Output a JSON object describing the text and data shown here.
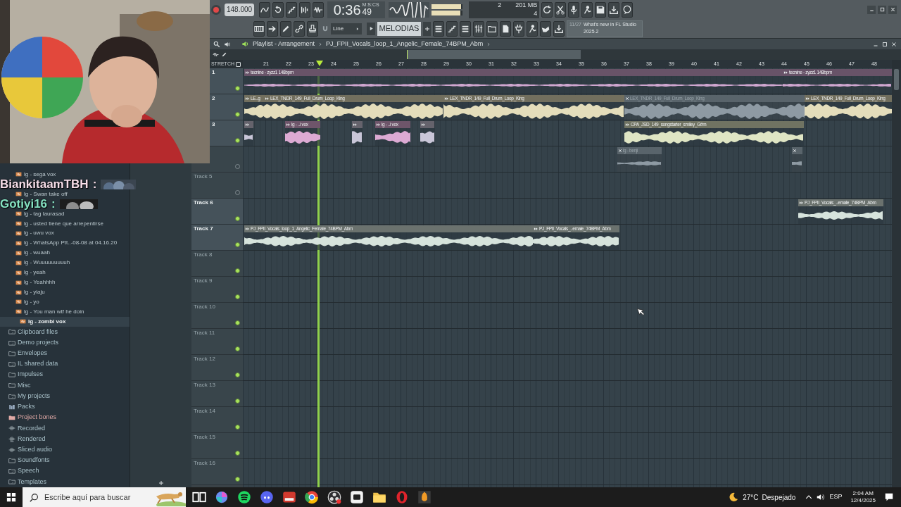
{
  "chat": [
    {
      "user": "BiankitaamTBH",
      "separator": ":",
      "color": "#f6dde8"
    },
    {
      "user": "Gotiyi16",
      "separator": ":",
      "color": "#86e3c3"
    }
  ],
  "toolbar": {
    "tempo": "148.000",
    "time": "0:36",
    "time_format": "M:S:CS",
    "time_cs": "49",
    "meters": [
      {
        "level": 0.95
      },
      {
        "level": 0.92
      }
    ],
    "cpu": "2",
    "memory": "201 MB",
    "polyphony": "4",
    "snap": "Line",
    "pattern": "MELODIAS",
    "news_count": "11/27",
    "news": "What's new in FL Studio 2025.2"
  },
  "playlist": {
    "title": "Playlist - Arrangement",
    "breadcrumb": "PJ_FPII_Vocals_loop_1_Angelic_Female_74BPM_Abm",
    "stretch": "STRETCH",
    "stretch_checked": false,
    "ruler": [
      "21",
      "22",
      "23",
      "24",
      "25",
      "26",
      "27",
      "28",
      "29",
      "30",
      "31",
      "32",
      "33",
      "34",
      "35",
      "36",
      "37",
      "38",
      "39",
      "40",
      "41",
      "42",
      "43",
      "44",
      "45",
      "46",
      "47",
      "48"
    ],
    "tracks": [
      {
        "label": "1",
        "on": true,
        "bright": true,
        "clips": [
          {
            "label": "tecnine - zyzz1 148bpm",
            "color": "#cfa6cf",
            "muted": false
          },
          {
            "label": "tecnine - zyzz1 148bpm",
            "color": "#cfa6cf",
            "muted": false
          }
        ]
      },
      {
        "label": "2",
        "on": true,
        "bright": true,
        "clips": [
          {
            "label": "LE..g",
            "color": "#e4ddbb",
            "muted": false
          },
          {
            "label": "LEX_TNDR_149_Full_Drum_Loop_King",
            "color": "#e4ddbb",
            "muted": false
          },
          {
            "label": "LEX_TNDR_149_Full_Drum_Loop_King",
            "color": "#e4ddbb",
            "muted": false
          },
          {
            "label": "LEX_TNDR_149_Full_Drum_Loop_King",
            "color": "#8e9aa3",
            "muted": true
          },
          {
            "label": "LEX_TNDR_149_Full_Drum_Loop_King",
            "color": "#e4ddbb",
            "muted": false
          }
        ]
      },
      {
        "label": "3",
        "on": true,
        "bright": true,
        "clips": [
          {
            "color": "#c9c6d8",
            "muted": false
          },
          {
            "label": "lg - ..i vox",
            "color": "#dcaad3",
            "muted": false
          },
          {
            "color": "#c9c6d8",
            "muted": false
          },
          {
            "label": "lg - ..i vox",
            "color": "#dcaad3",
            "muted": false
          },
          {
            "color": "#c9c6d8",
            "muted": false
          },
          {
            "label": "CPA_JSD_149_songstarter_smiley_G#m",
            "color": "#dfe5c4",
            "muted": false
          }
        ]
      },
      {
        "on": false,
        "bright": false,
        "clips": [
          {
            "label": "lg - benji",
            "color": "#8e9aa3",
            "muted": true
          },
          {
            "color": "#8e9aa3",
            "muted": true
          }
        ]
      },
      {
        "label": "Track 5",
        "on": false,
        "bright": false
      },
      {
        "label": "Track 6",
        "on": true,
        "bright": true,
        "clips": [
          {
            "label": "PJ_FPII_Vocals_..emale_74BPM_Abm",
            "color": "#d6e3dc",
            "muted": false
          }
        ]
      },
      {
        "label": "Track 7",
        "on": true,
        "bright": true,
        "clips": [
          {
            "label": "PJ_FPII_Vocals_loop_1_Angelic_Female_74BPM_Abm",
            "color": "#d6e3dc",
            "muted": false
          },
          {
            "label": "PJ_FPII_Vocals_..emale_74BPM_Abm",
            "color": "#d6e3dc",
            "muted": false
          }
        ]
      },
      {
        "label": "Track 8",
        "on": true,
        "bright": false
      },
      {
        "label": "Track 9",
        "on": true,
        "bright": false
      },
      {
        "label": "Track 10",
        "on": true,
        "bright": false
      },
      {
        "label": "Track 11",
        "on": true,
        "bright": false
      },
      {
        "label": "Track 12",
        "on": true,
        "bright": false
      },
      {
        "label": "Track 13",
        "on": true,
        "bright": false
      },
      {
        "label": "Track 14",
        "on": true,
        "bright": false
      },
      {
        "label": "Track 15",
        "on": true,
        "bright": false
      },
      {
        "label": "Track 16",
        "on": true,
        "bright": false
      }
    ]
  },
  "browser": {
    "items": [
      {
        "label": "lg - sega vox",
        "kind": "audio",
        "selected": false
      },
      {
        "label": "lg - Swan take off",
        "kind": "audio",
        "selected": false
      },
      {
        "label": "lg - tag laurasad",
        "kind": "audio",
        "selected": false
      },
      {
        "label": "lg - usted tiene que arrepentirse",
        "kind": "audio",
        "selected": false
      },
      {
        "label": "lg - uwu vox",
        "kind": "audio",
        "selected": false
      },
      {
        "label": "lg - WhatsApp Ptt..-08-08 at 04.16.20",
        "kind": "audio",
        "selected": false
      },
      {
        "label": "lg - wuaah",
        "kind": "audio",
        "selected": false
      },
      {
        "label": "lg - Wuuuuuuuuuh",
        "kind": "audio",
        "selected": false
      },
      {
        "label": "lg - yeah",
        "kind": "audio",
        "selected": false
      },
      {
        "label": "lg - Yeahhhh",
        "kind": "audio",
        "selected": false
      },
      {
        "label": "lg - yiaju",
        "kind": "audio",
        "selected": false
      },
      {
        "label": "lg - yo",
        "kind": "audio",
        "selected": false
      },
      {
        "label": "lg - You man wtf he doin",
        "kind": "audio",
        "selected": false
      },
      {
        "label": "lg - zombi vox",
        "kind": "audio",
        "selected": true
      },
      {
        "label": "Clipboard files",
        "kind": "link-folder"
      },
      {
        "label": "Demo projects",
        "kind": "link-folder"
      },
      {
        "label": "Envelopes",
        "kind": "folder"
      },
      {
        "label": "IL shared data",
        "kind": "link-folder"
      },
      {
        "label": "Impulses",
        "kind": "folder"
      },
      {
        "label": "Misc",
        "kind": "folder"
      },
      {
        "label": "My projects",
        "kind": "link-folder"
      },
      {
        "label": "Packs",
        "kind": "packs"
      },
      {
        "label": "Project bones",
        "kind": "link-folder",
        "color": "#e0a9a6"
      },
      {
        "label": "Recorded",
        "kind": "recorded"
      },
      {
        "label": "Rendered",
        "kind": "rendered"
      },
      {
        "label": "Sliced audio",
        "kind": "recorded"
      },
      {
        "label": "Soundfonts",
        "kind": "folder"
      },
      {
        "label": "Speech",
        "kind": "link-folder"
      },
      {
        "label": "Templates",
        "kind": "link-folder"
      }
    ]
  },
  "taskbar": {
    "search_placeholder": "Escribe aquí para buscar",
    "temperature": "27°C",
    "weather": "Despejado",
    "language": "ESP",
    "time": "2:04 AM",
    "date": "12/4/2025"
  }
}
